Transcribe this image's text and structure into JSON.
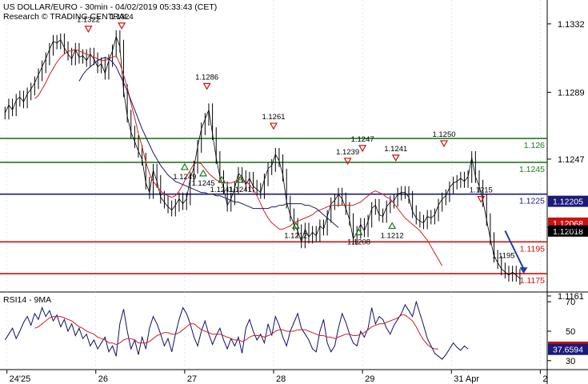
{
  "header": {
    "title": "US DOLLAR/EURO - 30min - 04/02/2019 05:33:43 (CET)",
    "credit": "Research © TRADING CENTRAL"
  },
  "colors": {
    "price": "#000000",
    "ma_fast": "#cc2222",
    "ma_slow": "#1a1a66",
    "support_resistance_green": "#1e7a1e",
    "pivot_blue": "#1a1a7a",
    "target_red": "#cc1111",
    "arrow": "#1f3fa0",
    "rsi": "#10106a",
    "rsi_ma": "#cc2222",
    "label_navy": "#1a1a7a",
    "label_red": "#cc1111",
    "label_black": "#000000"
  },
  "chart_data": [
    {
      "type": "line",
      "panel": "price",
      "y_axis": {
        "ylim": [
          1.1165,
          1.1345
        ],
        "ticks": [
          "1.1332",
          "1.1289",
          "1.1247",
          "1.1204",
          "1.1161"
        ],
        "tick_values": [
          1.1332,
          1.1289,
          1.1247,
          1.1204,
          1.1161
        ]
      },
      "x_axis": {
        "ticks": [
          "24'25",
          "26",
          "27",
          "28",
          "29",
          "31 Apr",
          "2"
        ],
        "tick_positions": [
          0.5,
          24.5,
          48.5,
          72.5,
          96.5,
          120.5,
          144.5
        ]
      },
      "series": [
        {
          "values": [
            1.1276,
            1.1281,
            1.1278,
            1.1284,
            1.1286,
            1.1283,
            1.1288,
            1.1291,
            1.1295,
            1.13,
            1.1305,
            1.131,
            1.1316,
            1.1321,
            1.132,
            1.1322,
            1.1317,
            1.1313,
            1.131,
            1.1316,
            1.1311,
            1.1312,
            1.1309,
            1.1313,
            1.131,
            1.1305,
            1.1307,
            1.1301,
            1.1309,
            1.1315,
            1.1324,
            1.1318,
            1.129,
            1.1274,
            1.1264,
            1.1258,
            1.1252,
            1.1247,
            1.1232,
            1.1226,
            1.124,
            1.1233,
            1.1223,
            1.122,
            1.1217,
            1.1215,
            1.1218,
            1.1222,
            1.1219,
            1.1222,
            1.1235,
            1.1242,
            1.1255,
            1.1266,
            1.1272,
            1.1278,
            1.1263,
            1.1248,
            1.1236,
            1.1229,
            1.1218,
            1.1222,
            1.1229,
            1.1238,
            1.1236,
            1.1231,
            1.1235,
            1.123,
            1.1228,
            1.1226,
            1.1234,
            1.1241,
            1.1243,
            1.125,
            1.1246,
            1.1237,
            1.122,
            1.1212,
            1.1206,
            1.1202,
            1.1195,
            1.1203,
            1.1198,
            1.1201,
            1.1199,
            1.1205,
            1.1203,
            1.1211,
            1.1219,
            1.1221,
            1.1225,
            1.1222,
            1.1216,
            1.1209,
            1.1197,
            1.1201,
            1.1206,
            1.1202,
            1.1208,
            1.1216,
            1.1218,
            1.1212,
            1.1211,
            1.1217,
            1.122,
            1.1221,
            1.1225,
            1.1226,
            1.1226,
            1.1223,
            1.1214,
            1.121,
            1.1208,
            1.1207,
            1.1211,
            1.121,
            1.1212,
            1.1218,
            1.1222,
            1.1224,
            1.1229,
            1.1232,
            1.1233,
            1.1235,
            1.1233,
            1.1236,
            1.1248,
            1.1236,
            1.123,
            1.1221,
            1.1209,
            1.1197,
            1.1186,
            1.1182,
            1.1178,
            1.1176,
            1.1174,
            1.1176,
            1.1174,
            1.1172
          ]
        },
        {
          "name": "MA fast",
          "values": [
            null,
            null,
            null,
            null,
            null,
            null,
            null,
            null,
            1.1285,
            1.1287,
            1.1291,
            1.1295,
            1.13,
            1.1304,
            1.1308,
            1.1311,
            1.1313,
            1.1315,
            1.1315,
            1.1316,
            1.1315,
            1.1314,
            1.1313,
            1.1312,
            1.1311,
            1.131,
            1.1309,
            1.1309,
            1.131,
            1.1311,
            1.1312,
            1.1307,
            1.13,
            1.1292,
            1.1282,
            1.1273,
            1.1263,
            1.1255,
            1.1245,
            1.1238,
            1.1233,
            1.123,
            1.1227,
            1.1225,
            1.1224,
            1.1223,
            1.1224,
            1.1227,
            1.1231,
            1.1236,
            1.124,
            1.1244,
            1.1245,
            1.1244,
            1.1241,
            1.1238,
            1.1236,
            1.1234,
            1.1233,
            1.1232,
            1.1232,
            1.1232,
            1.1233,
            1.1234,
            1.1234,
            1.1233,
            1.1231,
            1.1228,
            1.1224,
            1.1219,
            1.1214,
            1.121,
            1.1207,
            1.1205,
            1.1203,
            1.1203,
            1.1204,
            1.1205,
            1.1207,
            1.1208,
            1.1209,
            1.121,
            1.1211,
            1.1212,
            1.1214,
            1.1215,
            1.1216,
            1.1217,
            1.1218,
            1.1218,
            1.1218,
            1.1218,
            1.1218,
            1.1218,
            1.1218,
            1.1219,
            1.122,
            1.1222,
            1.1224,
            1.1226,
            1.1227,
            1.1226,
            1.1225,
            1.1223,
            1.1222,
            1.1219,
            1.1216,
            1.1213,
            1.121,
            1.1208,
            1.1206,
            1.1204,
            1.1202,
            1.1199,
            1.1196,
            1.1192,
            1.1188,
            1.1184,
            1.118
          ]
        },
        {
          "name": "MA slow",
          "values": [
            null,
            null,
            null,
            null,
            null,
            null,
            null,
            null,
            null,
            null,
            null,
            null,
            null,
            null,
            null,
            null,
            null,
            null,
            null,
            null,
            1.1296,
            1.13,
            1.1303,
            1.1305,
            1.1307,
            1.1309,
            1.131,
            1.1311,
            1.131,
            1.1308,
            1.1305,
            1.13,
            1.1295,
            1.129,
            1.1284,
            1.1278,
            1.1272,
            1.1266,
            1.1261,
            1.1256,
            1.1251,
            1.1247,
            1.1243,
            1.124,
            1.1237,
            1.1235,
            1.1233,
            1.1232,
            1.1231,
            1.123,
            1.1229,
            1.1228,
            1.1227,
            1.1226,
            1.1226,
            1.1225,
            1.1225,
            1.1224,
            1.1224,
            1.1223,
            1.1222,
            1.1221,
            1.122,
            1.122,
            1.1219,
            1.1218,
            1.1217,
            1.1216,
            1.1216,
            1.1216,
            1.1216,
            1.1216,
            1.1217,
            1.1217,
            1.1218,
            1.1218,
            1.1219,
            1.1219,
            1.1219,
            1.1219,
            1.1219,
            1.1218,
            1.1218,
            1.1217,
            1.1216,
            1.1214,
            1.1212,
            1.121,
            1.1208,
            1.1206,
            1.1204
          ]
        }
      ],
      "levels": [
        {
          "value": 1.126,
          "label": "1.126",
          "color": "#1e7a1e"
        },
        {
          "value": 1.1245,
          "label": "1.1245",
          "color": "#1e7a1e"
        },
        {
          "value": 1.1225,
          "label": "1.1225",
          "color": "#1a1a7a"
        },
        {
          "value": 1.1195,
          "label": "1.1195",
          "color": "#cc1111"
        },
        {
          "value": 1.1175,
          "label": "1.1175",
          "color": "#cc1111"
        }
      ],
      "right_tags": [
        {
          "value": 1.12205,
          "label": "1.12205",
          "style": "navy"
        },
        {
          "value": 1.12068,
          "label": "1.12068",
          "style": "red"
        },
        {
          "value": 1.12018,
          "label": "1.12018",
          "style": "black"
        }
      ],
      "annotations": [
        {
          "kind": "high",
          "x": 22.5,
          "value": 1.1322,
          "label": "1.1322"
        },
        {
          "kind": "high",
          "x": 31.5,
          "value": 1.1324,
          "label": "1.1324"
        },
        {
          "kind": "high",
          "x": 54.5,
          "value": 1.1286,
          "label": "1.1286"
        },
        {
          "kind": "high",
          "x": 72.5,
          "value": 1.1261,
          "label": "1.1261"
        },
        {
          "kind": "high",
          "x": 92.5,
          "value": 1.1239,
          "label": "1.1239"
        },
        {
          "kind": "high",
          "x": 96.5,
          "value": 1.1247,
          "label": "1.1247"
        },
        {
          "kind": "high",
          "x": 105.5,
          "value": 1.1241,
          "label": "1.1241"
        },
        {
          "kind": "high",
          "x": 118.5,
          "value": 1.125,
          "label": "1.1250"
        },
        {
          "kind": "high",
          "x": 128.5,
          "value": 1.1215,
          "label": "1.1215"
        },
        {
          "kind": "low",
          "x": 48.5,
          "value": 1.1249,
          "label": "1.1249"
        },
        {
          "kind": "low",
          "x": 53.5,
          "value": 1.1245,
          "label": "1.1245"
        },
        {
          "kind": "low",
          "x": 58.5,
          "value": 1.1241,
          "label": "1.1241"
        },
        {
          "kind": "low",
          "x": 63.5,
          "value": 1.1241,
          "label": "1.1241"
        },
        {
          "kind": "low",
          "x": 78.5,
          "value": 1.1212,
          "label": "1.1212"
        },
        {
          "kind": "low",
          "x": 95.5,
          "value": 1.1208,
          "label": "1.1208"
        },
        {
          "kind": "low",
          "x": 104.5,
          "value": 1.1212,
          "label": "1.1212"
        }
      ],
      "plain_labels": [
        {
          "x": 131.5,
          "value": 1.119,
          "label": "1.1195"
        }
      ],
      "forecast_arrow": {
        "from": [
          135.0,
          1.1202
        ],
        "to": [
          140.0,
          1.1175
        ]
      }
    },
    {
      "type": "line",
      "panel": "rsi",
      "title": "RSI14 - 9MA",
      "y_axis": {
        "ylim": [
          25,
          75
        ],
        "ticks": [
          "70",
          "50",
          "30"
        ],
        "tick_values": [
          70,
          50,
          30
        ]
      },
      "current_values": [
        {
          "value": 39.1492,
          "label": "39.1492",
          "style": "red"
        },
        {
          "value": 37.6594,
          "label": "37.6594",
          "style": "navy"
        }
      ],
      "series": [
        {
          "values": [
            44,
            48,
            52,
            45,
            50,
            56,
            60,
            54,
            62,
            58,
            66,
            60,
            64,
            57,
            61,
            53,
            58,
            50,
            55,
            47,
            52,
            45,
            48,
            40,
            44,
            38,
            42,
            46,
            36,
            40,
            33,
            55,
            65,
            50,
            38,
            44,
            34,
            46,
            38,
            52,
            60,
            55,
            48,
            40,
            45,
            36,
            48,
            58,
            66,
            62,
            55,
            46,
            40,
            50,
            57,
            48,
            41,
            47,
            52,
            44,
            38,
            45,
            40,
            46,
            35,
            52,
            58,
            50,
            44,
            48,
            42,
            55,
            47,
            60,
            54,
            46,
            40,
            50,
            56,
            62,
            52,
            48,
            44,
            38,
            36,
            50,
            58,
            42,
            36,
            40,
            52,
            62,
            56,
            48,
            42,
            40,
            50,
            46,
            52,
            66,
            55,
            60,
            58,
            52,
            48,
            54,
            58,
            62,
            68,
            64,
            60,
            70,
            62,
            54,
            45,
            40,
            35,
            33,
            31,
            34,
            38,
            42,
            39,
            37,
            40,
            38
          ]
        },
        {
          "name": "MA",
          "values": [
            null,
            null,
            null,
            null,
            null,
            null,
            null,
            null,
            52,
            53,
            55,
            57,
            59,
            60,
            60,
            60,
            59,
            58,
            57,
            55,
            53,
            52,
            50,
            49,
            48,
            46,
            45,
            44,
            42,
            42,
            41,
            42,
            44,
            45,
            45,
            44,
            42,
            42,
            42,
            43,
            45,
            47,
            48,
            49,
            49,
            48,
            48,
            49,
            51,
            53,
            55,
            55,
            53,
            51,
            50,
            49,
            48,
            48,
            48,
            47,
            46,
            45,
            44,
            44,
            43,
            44,
            46,
            47,
            47,
            47,
            46,
            47,
            48,
            50,
            51,
            51,
            50,
            50,
            50,
            51,
            51,
            51,
            50,
            49,
            48,
            47,
            47,
            46,
            46,
            45,
            46,
            47,
            48,
            48,
            47,
            47,
            48,
            49,
            51,
            53,
            54,
            55,
            55,
            56,
            57,
            58,
            59,
            61,
            61,
            59,
            57,
            53,
            48,
            44,
            41,
            39,
            38,
            38
          ]
        }
      ]
    }
  ]
}
